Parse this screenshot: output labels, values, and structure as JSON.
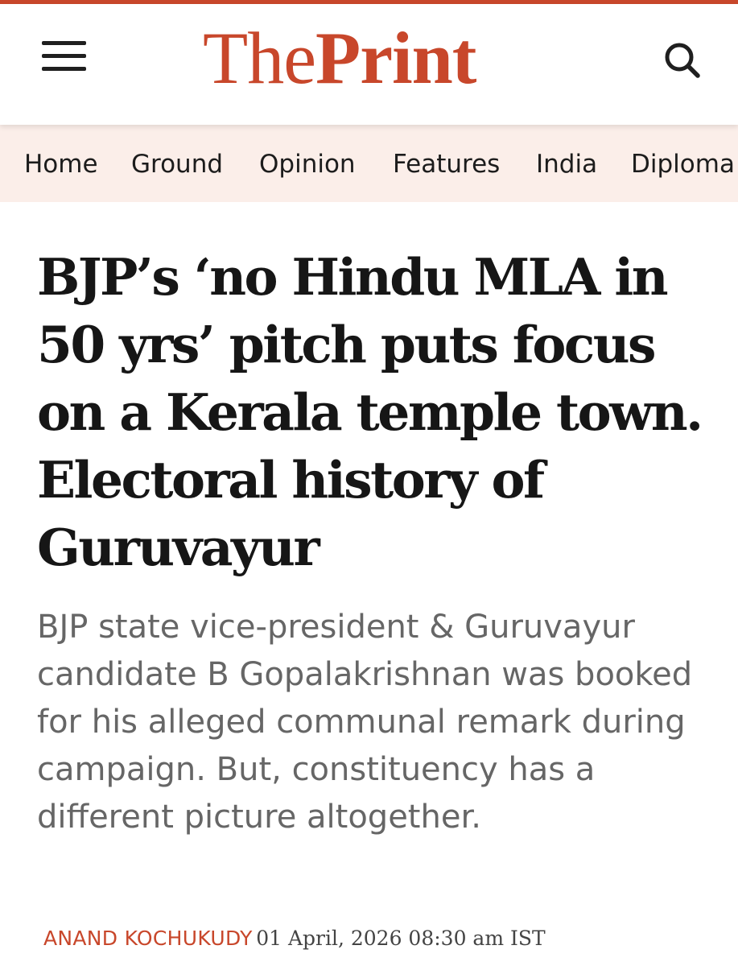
{
  "header": {
    "logo_the": "The",
    "logo_print": "Print",
    "menu_icon": "hamburger-menu-icon",
    "search_icon": "search-icon",
    "brand_color": "#c8472b"
  },
  "nav": {
    "items": [
      {
        "label": "Home"
      },
      {
        "label": "Ground"
      },
      {
        "label": "Opinion"
      },
      {
        "label": "Features"
      },
      {
        "label": "India"
      },
      {
        "label": "Diploma"
      }
    ],
    "background_color": "#fbeee9"
  },
  "article": {
    "headline": "BJP’s ‘no Hindu MLA in 50 yrs’ pitch puts focus on a Kerala temple town. Electoral history of Guruvayur",
    "summary": "BJP state vice-president & Guruvayur candidate B Gopalakrishnan was booked for his alleged communal remark during campaign. But, constituency has a different picture altogether.",
    "author": "ANAND KOCHUKUDY",
    "date": "01 April, 2026 08:30 am IST"
  }
}
